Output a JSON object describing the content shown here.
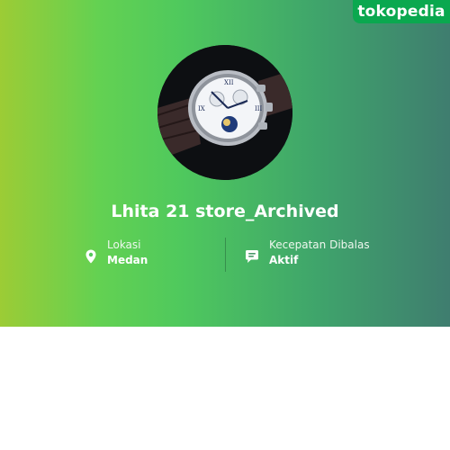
{
  "brand": {
    "logo_text": "tokopedia"
  },
  "store": {
    "name": "Lhita 21 store_Archived",
    "avatar_icon": "wristwatch-photo"
  },
  "info": {
    "location": {
      "label": "Lokasi",
      "value": "Medan",
      "icon": "location-pin-icon"
    },
    "response": {
      "label": "Kecepatan Dibalas",
      "value": "Aktif",
      "icon": "chat-bubble-icon"
    }
  },
  "colors": {
    "gradient_start": "#9ccc35",
    "gradient_mid": "#4fc95d",
    "gradient_end": "#3f7d6f",
    "brand_green": "#0aa84f"
  }
}
